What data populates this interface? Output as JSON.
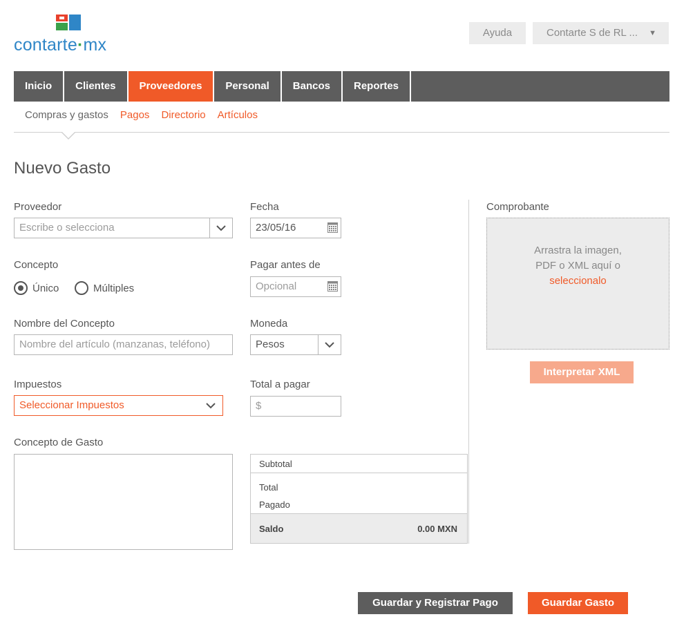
{
  "brand": {
    "name": "contarte",
    "dot": "·",
    "suffix": "mx",
    "colors": {
      "blue": "#2f86c7",
      "green": "#3aa14a",
      "red": "#e8412c",
      "orange": "#f05a28"
    }
  },
  "header": {
    "help_label": "Ayuda",
    "company_label": "Contarte S de RL ...",
    "caret": "▼"
  },
  "nav": {
    "items": [
      {
        "label": "Inicio",
        "active": false
      },
      {
        "label": "Clientes",
        "active": false
      },
      {
        "label": "Proveedores",
        "active": true
      },
      {
        "label": "Personal",
        "active": false
      },
      {
        "label": "Bancos",
        "active": false
      },
      {
        "label": "Reportes",
        "active": false
      }
    ]
  },
  "subnav": {
    "items": [
      {
        "label": "Compras y gastos",
        "current": true
      },
      {
        "label": "Pagos",
        "current": false
      },
      {
        "label": "Directorio",
        "current": false
      },
      {
        "label": "Artículos",
        "current": false
      }
    ]
  },
  "page": {
    "title": "Nuevo Gasto"
  },
  "form": {
    "proveedor": {
      "label": "Proveedor",
      "placeholder": "Escribe o selecciona"
    },
    "fecha": {
      "label": "Fecha",
      "value": "23/05/16"
    },
    "concepto": {
      "label": "Concepto",
      "option_single": "Único",
      "option_multiple": "Múltiples",
      "selected": "Único"
    },
    "pagar_antes": {
      "label": "Pagar antes de",
      "placeholder": "Opcional"
    },
    "nombre_concepto": {
      "label": "Nombre del Concepto",
      "placeholder": "Nombre del artículo (manzanas,  teléfono)"
    },
    "moneda": {
      "label": "Moneda",
      "value": "Pesos"
    },
    "impuestos": {
      "label": "Impuestos",
      "value": "Seleccionar Impuestos"
    },
    "total_pagar": {
      "label": "Total a pagar",
      "placeholder": "$"
    },
    "concepto_gasto": {
      "label": "Concepto de Gasto"
    }
  },
  "totals": {
    "subtotal_label": "Subtotal",
    "total_label": "Total",
    "pagado_label": "Pagado",
    "saldo_label": "Saldo",
    "saldo_value": "0.00 MXN"
  },
  "comprobante": {
    "label": "Comprobante",
    "line1": "Arrastra la imagen,",
    "line2": "PDF o XML aquí o",
    "link": "seleccionalo",
    "button": "Interpretar XML"
  },
  "actions": {
    "save_pay_label": "Guardar y Registrar Pago",
    "save_label": "Guardar Gasto"
  }
}
